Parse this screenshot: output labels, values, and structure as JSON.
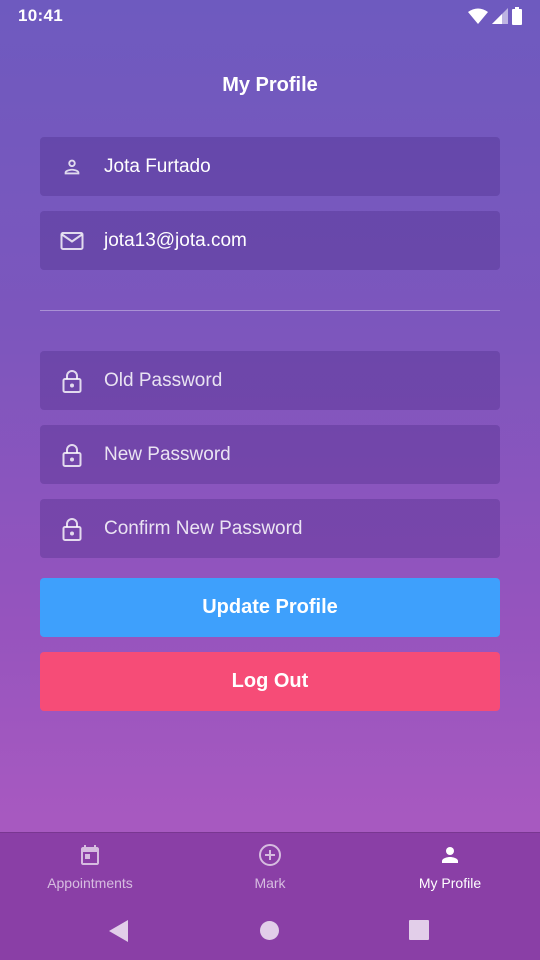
{
  "status_bar": {
    "time": "10:41"
  },
  "header": {
    "title": "My Profile"
  },
  "profile_fields": [
    {
      "icon": "person-icon",
      "value": "Jota Furtado"
    },
    {
      "icon": "email-icon",
      "value": "jota13@jota.com"
    }
  ],
  "password_fields": [
    {
      "icon": "lock-icon",
      "placeholder": "Old Password"
    },
    {
      "icon": "lock-icon",
      "placeholder": "New Password"
    },
    {
      "icon": "lock-icon",
      "placeholder": "Confirm New Password"
    }
  ],
  "buttons": {
    "update_label": "Update Profile",
    "logout_label": "Log Out"
  },
  "bottom_nav": [
    {
      "label": "Appointments",
      "icon": "calendar-icon",
      "active": false
    },
    {
      "label": "Mark",
      "icon": "add-circle-icon",
      "active": false
    },
    {
      "label": "My Profile",
      "icon": "person-icon",
      "active": true
    }
  ],
  "colors": {
    "update_button": "#3ea0fc",
    "logout_button": "#f64c77",
    "nav_background": "#8a3fa6"
  }
}
